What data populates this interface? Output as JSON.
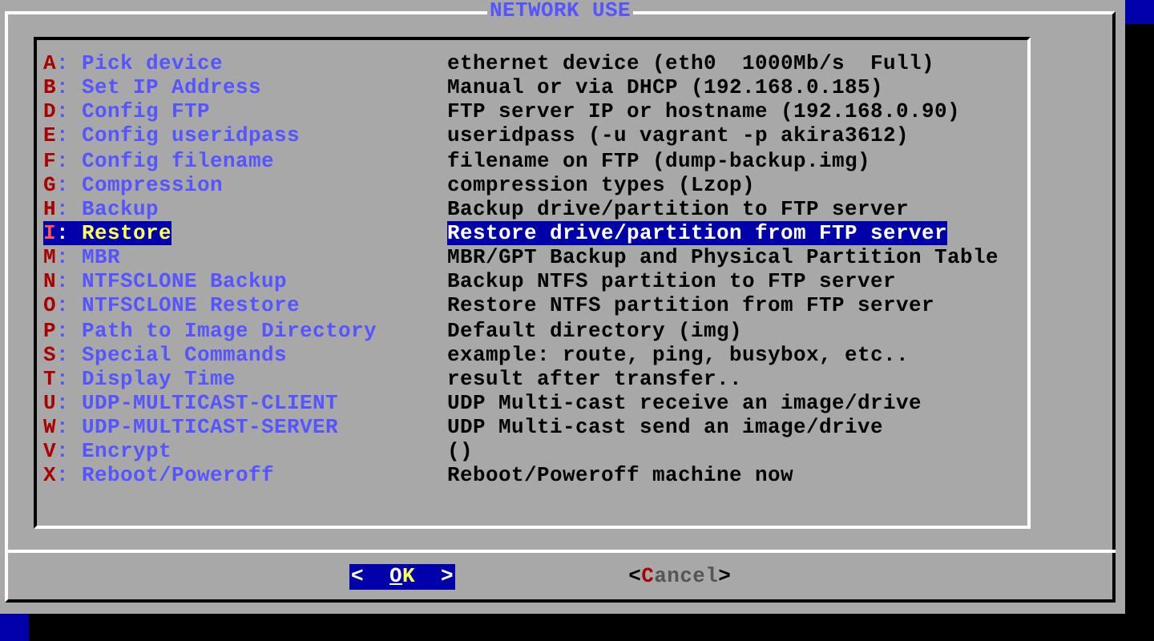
{
  "dialog": {
    "title": "NETWORK USE"
  },
  "items": [
    {
      "key": "A",
      "separator": ":",
      "label": "Pick device",
      "description": "ethernet device (eth0  1000Mb/s  Full)",
      "selected": false
    },
    {
      "key": "B",
      "separator": ":",
      "label": "Set IP Address",
      "description": "Manual or via DHCP (192.168.0.185)",
      "selected": false
    },
    {
      "key": "D",
      "separator": ":",
      "label": "Config FTP",
      "description": "FTP server IP or hostname (192.168.0.90)",
      "selected": false
    },
    {
      "key": "E",
      "separator": ":",
      "label": "Config useridpass",
      "description": "useridpass (-u vagrant -p akira3612)",
      "selected": false
    },
    {
      "key": "F",
      "separator": ":",
      "label": "Config filename",
      "description": "filename on FTP (dump-backup.img)",
      "selected": false
    },
    {
      "key": "G",
      "separator": ":",
      "label": "Compression",
      "description": "compression types (Lzop)",
      "selected": false
    },
    {
      "key": "H",
      "separator": ":",
      "label": "Backup",
      "description": "Backup drive/partition to FTP server",
      "selected": false
    },
    {
      "key": "I",
      "separator": ":",
      "label": "Restore",
      "description": "Restore drive/partition from FTP server",
      "selected": true
    },
    {
      "key": "M",
      "separator": ":",
      "label": "MBR",
      "description": "MBR/GPT Backup and Physical Partition Table",
      "selected": false
    },
    {
      "key": "N",
      "separator": ":",
      "label": "NTFSCLONE Backup",
      "description": "Backup NTFS partition to FTP server",
      "selected": false
    },
    {
      "key": "O",
      "separator": ":",
      "label": "NTFSCLONE Restore",
      "description": "Restore NTFS partition from FTP server",
      "selected": false
    },
    {
      "key": "P",
      "separator": ":",
      "label": "Path to Image Directory",
      "description": "Default directory (img)",
      "selected": false
    },
    {
      "key": "S",
      "separator": ":",
      "label": "Special Commands",
      "description": "example: route, ping, busybox, etc..",
      "selected": false
    },
    {
      "key": "T",
      "separator": ":",
      "label": "Display Time",
      "description": "result after transfer..",
      "selected": false
    },
    {
      "key": "U",
      "separator": ":",
      "label": "UDP-MULTICAST-CLIENT",
      "description": "UDP Multi-cast receive an image/drive",
      "selected": false
    },
    {
      "key": "W",
      "separator": ":",
      "label": "UDP-MULTICAST-SERVER",
      "description": "UDP Multi-cast send an image/drive",
      "selected": false
    },
    {
      "key": "V",
      "separator": ":",
      "label": "Encrypt",
      "description": "()",
      "selected": false
    },
    {
      "key": "X",
      "separator": ":",
      "label": "Reboot/Poweroff",
      "description": "Reboot/Poweroff machine now",
      "selected": false
    }
  ],
  "buttons": [
    {
      "open": "<",
      "hotkey": "O",
      "rest": "K",
      "close": ">",
      "selected": true
    },
    {
      "open": "<",
      "hotkey": "C",
      "rest": "ancel",
      "close": ">",
      "selected": false
    }
  ]
}
